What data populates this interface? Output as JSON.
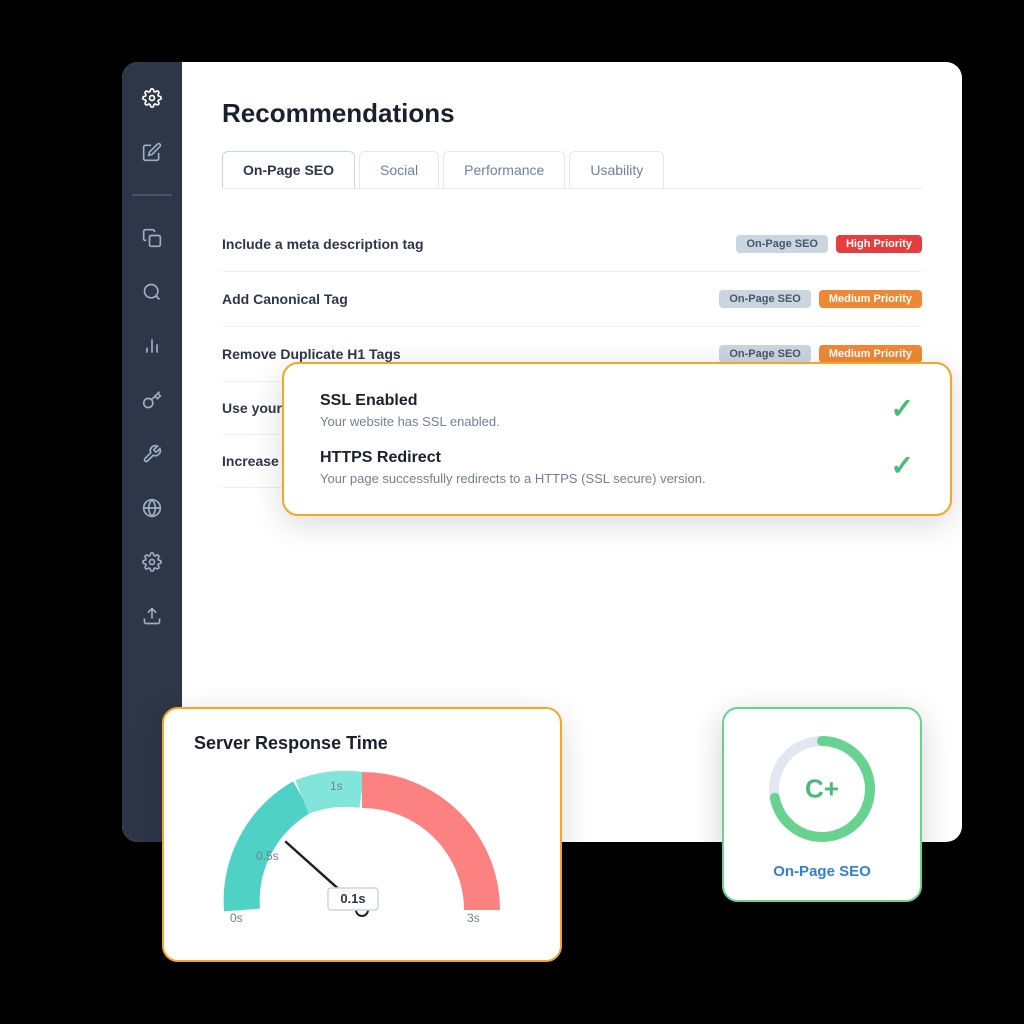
{
  "app": {
    "title": "Recommendations"
  },
  "sidebar": {
    "icons": [
      {
        "name": "settings-icon",
        "symbol": "⚙"
      },
      {
        "name": "edit-icon",
        "symbol": "✏"
      },
      {
        "name": "copy-icon",
        "symbol": "❐"
      },
      {
        "name": "search-icon",
        "symbol": "🔍"
      },
      {
        "name": "chart-icon",
        "symbol": "📊"
      },
      {
        "name": "key-icon",
        "symbol": "🔑"
      },
      {
        "name": "tool-icon",
        "symbol": "🔧"
      },
      {
        "name": "globe-icon",
        "symbol": "🌐"
      },
      {
        "name": "gear-icon",
        "symbol": "⚙"
      },
      {
        "name": "upload-icon",
        "symbol": "↑"
      }
    ]
  },
  "tabs": [
    {
      "label": "On-Page SEO",
      "active": true
    },
    {
      "label": "Social",
      "active": false
    },
    {
      "label": "Performance",
      "active": false
    },
    {
      "label": "Usability",
      "active": false
    }
  ],
  "recommendations": [
    {
      "label": "Include a meta description tag",
      "badge_category": "On-Page SEO",
      "badge_priority": "High Priority",
      "priority_color": "high"
    },
    {
      "label": "Add Canonical Tag",
      "badge_category": "On-Page SEO",
      "badge_priority": "Medium Priority",
      "priority_color": "medium"
    },
    {
      "label": "Remove Duplicate H1 Tags",
      "badge_category": "On-Page SEO",
      "badge_priority": "Medium Priority",
      "priority_color": "medium"
    },
    {
      "label": "Use your main keyword in title tags",
      "badge_category": "",
      "badge_priority": "",
      "priority_color": ""
    },
    {
      "label": "Increase page text content",
      "badge_category": "",
      "badge_priority": "",
      "priority_color": ""
    }
  ],
  "ssl_card": {
    "items": [
      {
        "title": "SSL Enabled",
        "description": "Your website has SSL enabled.",
        "status": "pass"
      },
      {
        "title": "HTTPS Redirect",
        "description": "Your page successfully redirects to a HTTPS (SSL secure) version.",
        "status": "pass"
      }
    ]
  },
  "server_card": {
    "title": "Server Response Time",
    "value": "0.1s",
    "labels": [
      "0s",
      "0.5s",
      "1s",
      "3s"
    ],
    "gauge": {
      "segments": [
        {
          "color": "#4fd1c5",
          "label": "0-0.5s"
        },
        {
          "color": "#81e6d9",
          "label": "0.5-1s"
        },
        {
          "color": "#fc8181",
          "label": "1-3s"
        }
      ],
      "needle_angle": -75
    }
  },
  "score_card": {
    "grade": "C+",
    "category": "On-Page SEO",
    "arc_color": "#68d391",
    "arc_bg": "#e2e8f0",
    "arc_percent": 0.72
  }
}
